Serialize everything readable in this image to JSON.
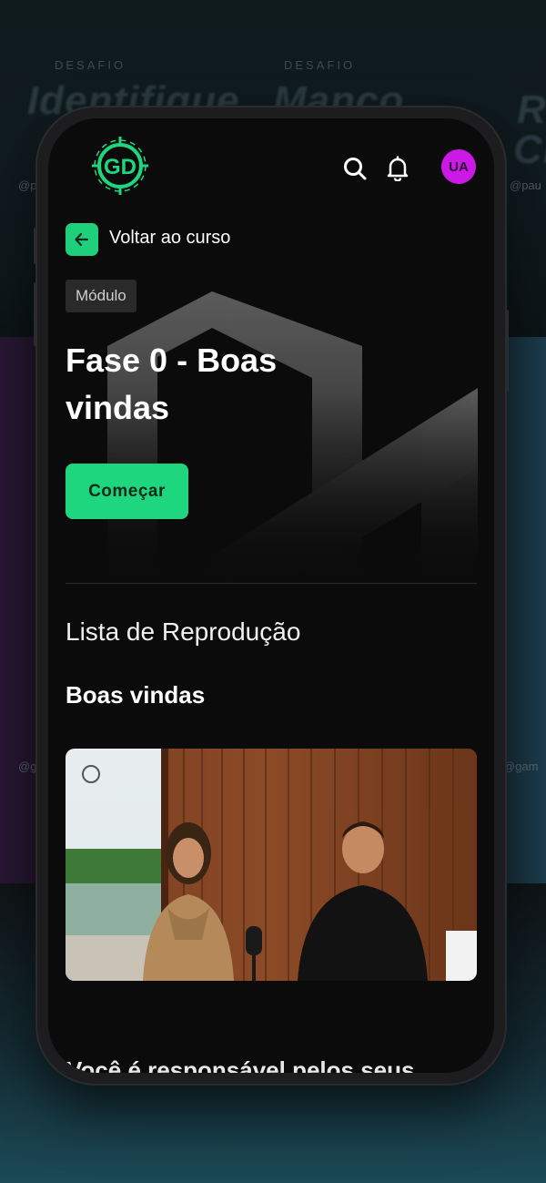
{
  "background": {
    "titles": [
      "Identifique",
      "Manco",
      "Re",
      "Cr"
    ],
    "kicker": [
      "DESAFIO",
      "DESAFIO"
    ],
    "handles": [
      "@pau",
      "@pau",
      "@g",
      "@gam"
    ]
  },
  "header": {
    "logo": "GD",
    "search_icon": "search-icon",
    "bell_icon": "bell-icon",
    "avatar_initials": "UA",
    "avatar_color": "#cd19e6"
  },
  "nav": {
    "back_label": "Voltar ao curso"
  },
  "hero": {
    "badge": "Módulo",
    "title": "Fase 0 - Boas vindas",
    "cta_label": "Começar",
    "accent_color": "#1ed67d"
  },
  "playlist": {
    "section_title": "Lista de Reprodução",
    "module_title": "Boas vindas",
    "next_title": "Você é responsável pelos seus"
  }
}
